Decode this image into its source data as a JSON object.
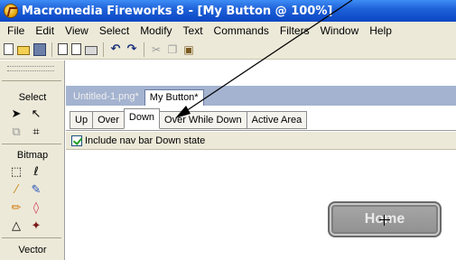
{
  "window": {
    "title": "Macromedia Fireworks 8 - [My Button @ 100%]"
  },
  "menu": [
    "File",
    "Edit",
    "View",
    "Select",
    "Modify",
    "Text",
    "Commands",
    "Filters",
    "Window",
    "Help"
  ],
  "toolbar": {
    "icons": [
      "new-icon",
      "open-icon",
      "save-icon",
      "document-icon",
      "export-icon",
      "print-icon",
      "undo-icon",
      "redo-icon",
      "cut-icon",
      "copy-icon",
      "paste-icon"
    ]
  },
  "tools_panel": {
    "sections": [
      "Select",
      "Bitmap",
      "Vector"
    ]
  },
  "document_tabs": [
    "Untitled-1.png*",
    "My Button*"
  ],
  "state_tabs": [
    "Up",
    "Over",
    "Down",
    "Over While Down",
    "Active Area"
  ],
  "active_state_tab": "Down",
  "options": {
    "include_down_state_label": "Include nav bar Down state",
    "include_down_state_checked": true
  },
  "canvas": {
    "button_label": "Home"
  }
}
